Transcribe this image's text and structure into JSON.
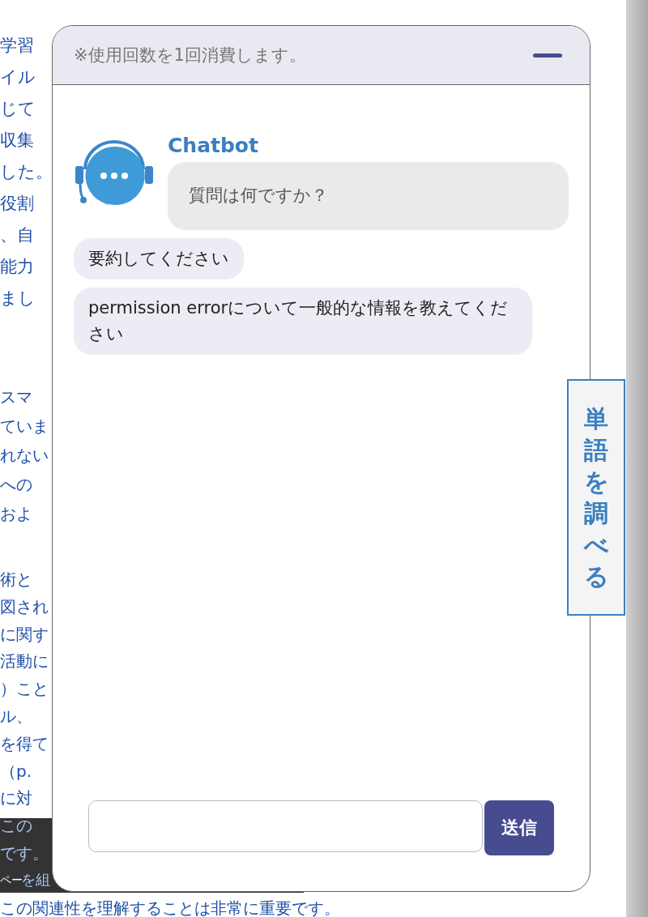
{
  "article": [
    {
      "lines": [
        "学習",
        "イル",
        "じて",
        "収集",
        "した。",
        "役割",
        "、自",
        "能力",
        "まし"
      ]
    },
    {
      "lines": [
        "スマ",
        "ていま",
        "れない",
        "への",
        "およ"
      ]
    },
    {
      "lines": [
        "術と",
        "図され",
        "に関す",
        "活動に",
        "）こと",
        "ル、",
        "を得て",
        "（p.",
        "に対",
        "この",
        "です。",
        "を組",
        "この関連性を理解することは非常に重要です。"
      ]
    }
  ],
  "tooltip": {
    "text": "ペー"
  },
  "chat": {
    "notice": "※使用回数を1回消費します。",
    "bot_name": "Chatbot",
    "messages": [
      {
        "kind": "bot",
        "text": "質問は何ですか？"
      },
      {
        "kind": "user",
        "text": "要約してください"
      },
      {
        "kind": "user",
        "text": "permission errorについて一般的な情報を教えてください"
      }
    ],
    "send_label": "送信"
  },
  "side_button": {
    "label": "単語を調べる"
  }
}
